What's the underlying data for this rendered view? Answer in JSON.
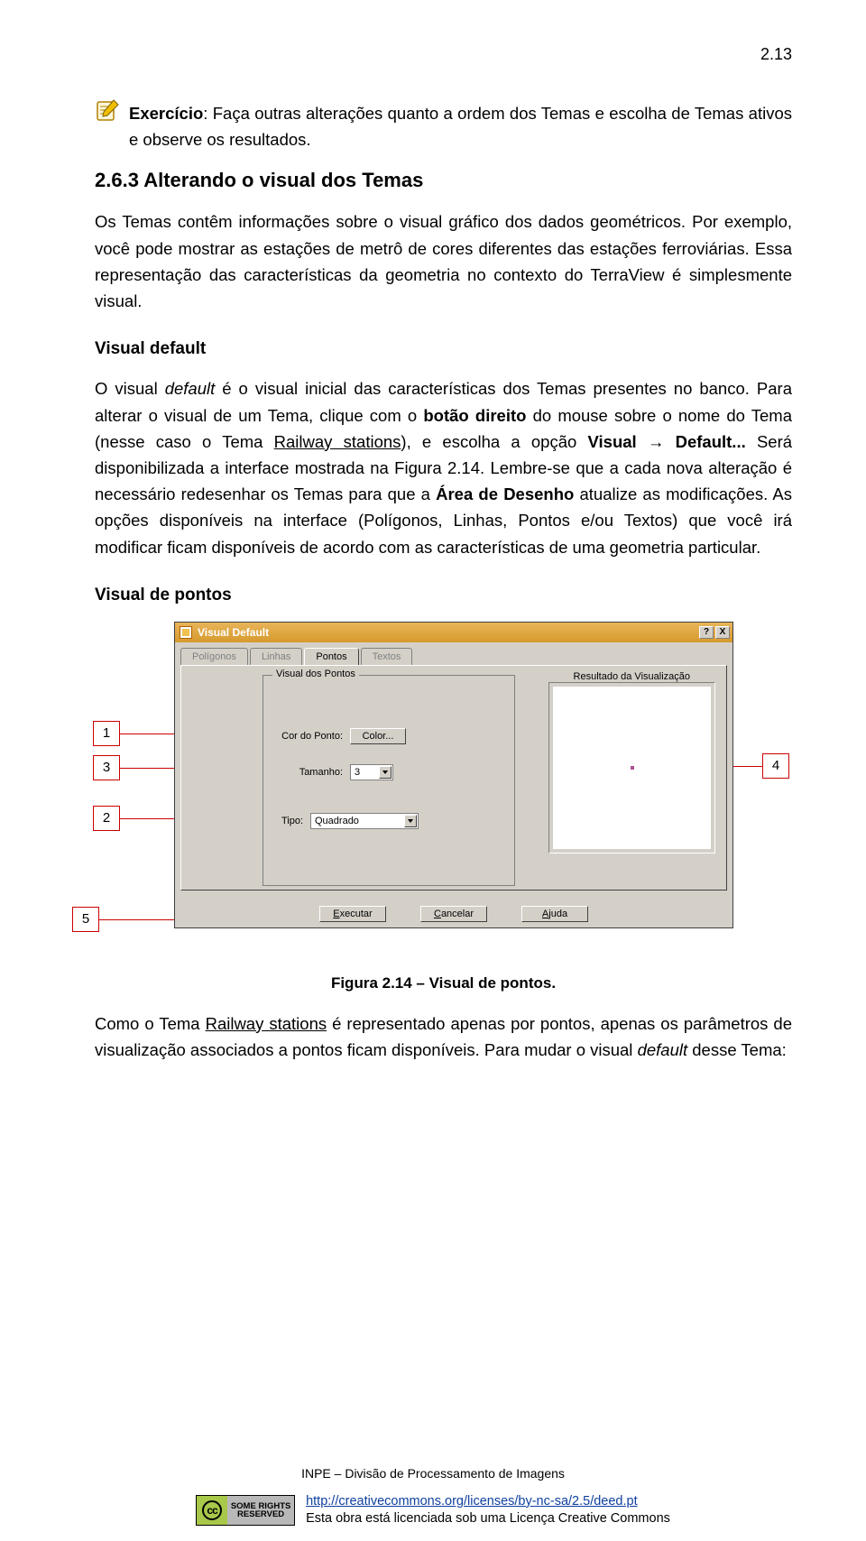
{
  "page_number": "2.13",
  "exercise": {
    "label": "Exercício",
    "text": ": Faça outras alterações quanto a ordem dos Temas e escolha de Temas ativos e observe os resultados."
  },
  "section_title": "2.6.3 Alterando o visual dos Temas",
  "para_1": "Os Temas contêm informações sobre o visual gráfico dos dados geométricos. Por exemplo, você pode mostrar as estações de metrô de cores diferentes das estações ferroviárias. Essa representação das características da geometria no contexto do TerraView é simplesmente visual.",
  "sub_1_title": "Visual default",
  "para_2_a": "O visual ",
  "para_2_b": "default",
  "para_2_c": " é o visual inicial das características dos Temas presentes no banco. Para alterar o visual de um Tema, clique com o ",
  "para_2_d": "botão direito",
  "para_2_e": " do mouse sobre o nome do Tema (nesse caso o Tema ",
  "para_2_f": "Railway stations",
  "para_2_g": "), e escolha a opção ",
  "para_2_h": "Visual → Default...",
  "para_2_i": " Será disponibilizada a interface mostrada na Figura 2.14. Lembre-se que a cada nova alteração é necessário redesenhar os Temas para que a ",
  "para_2_j": "Área de Desenho",
  "para_2_k": " atualize as modificações. As opções disponíveis na interface (Polígonos, Linhas, Pontos e/ou Textos) que você irá modificar ficam disponíveis de acordo com as características de uma geometria particular.",
  "sub_2_title": "Visual de pontos",
  "dialog": {
    "title": "Visual Default",
    "tabs": [
      "Polígonos",
      "Linhas",
      "Pontos",
      "Textos"
    ],
    "active_tab": 2,
    "group_label": "Visual dos Pontos",
    "fields": {
      "color_label": "Cor do Ponto:",
      "color_btn": "Color...",
      "size_label": "Tamanho:",
      "size_value": "3",
      "type_label": "Tipo:",
      "type_value": "Quadrado"
    },
    "preview_label": "Resultado da Visualização",
    "buttons": {
      "run": "Executar",
      "cancel": "Cancelar",
      "help": "Ajuda"
    },
    "winbtns": {
      "help": "?",
      "close": "X"
    },
    "callouts": {
      "c1": "1",
      "c2": "2",
      "c3": "3",
      "c4": "4",
      "c5": "5"
    }
  },
  "figure_caption": "Figura 2.14 – Visual de pontos.",
  "para_3_a": "Como o Tema ",
  "para_3_b": "Railway stations",
  "para_3_c": " é representado apenas por pontos, apenas os parâmetros de visualização associados a pontos ficam disponíveis.  Para mudar o visual ",
  "para_3_d": "default",
  "para_3_e": " desse Tema:",
  "footer_org": "INPE – Divisão de Processamento de Imagens",
  "cc": {
    "badge": "SOME RIGHTS RESERVED",
    "url": "http://creativecommons.org/licenses/by-nc-sa/2.5/deed.pt",
    "license_text": "Esta obra está licenciada sob uma Licença Creative Commons"
  }
}
